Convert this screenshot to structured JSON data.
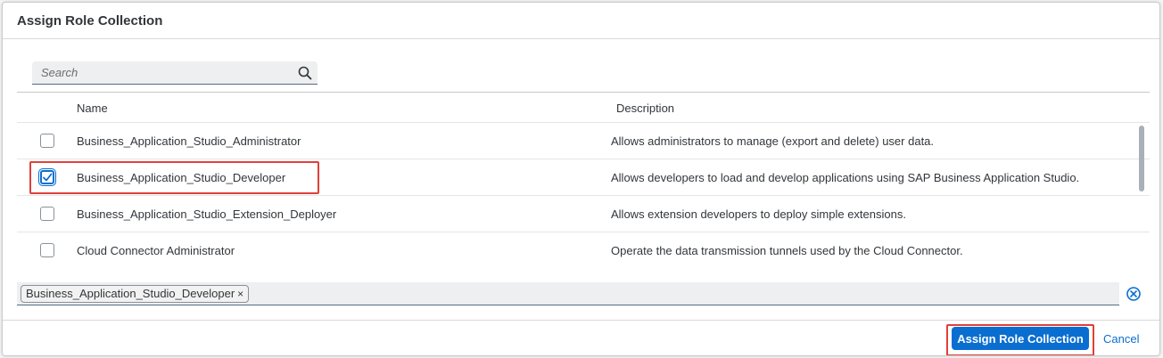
{
  "dialog": {
    "title": "Assign Role Collection"
  },
  "search": {
    "placeholder": "Search",
    "value": ""
  },
  "table": {
    "columns": {
      "name": "Name",
      "description": "Description"
    },
    "rows": [
      {
        "name": "Business_Application_Studio_Administrator",
        "description": "Allows administrators to manage (export and delete) user data.",
        "checked": false
      },
      {
        "name": "Business_Application_Studio_Developer",
        "description": "Allows developers to load and develop applications using SAP Business Application Studio.",
        "checked": true
      },
      {
        "name": "Business_Application_Studio_Extension_Deployer",
        "description": "Allows extension developers to deploy simple extensions.",
        "checked": false
      },
      {
        "name": "Cloud Connector Administrator",
        "description": "Operate the data transmission tunnels used by the Cloud Connector.",
        "checked": false
      }
    ]
  },
  "selection": {
    "tokens": [
      "Business_Application_Studio_Developer"
    ],
    "token_remove_glyph": "×"
  },
  "footer": {
    "primary_label": "Assign Role Collection",
    "cancel_label": "Cancel"
  },
  "colors": {
    "accent": "#0a6ed1",
    "highlight": "#e0403a"
  },
  "icons": {
    "search": "search-icon",
    "checkmark": "checkmark-icon",
    "clear": "clear-all-icon",
    "token_remove": "token-remove-icon"
  }
}
